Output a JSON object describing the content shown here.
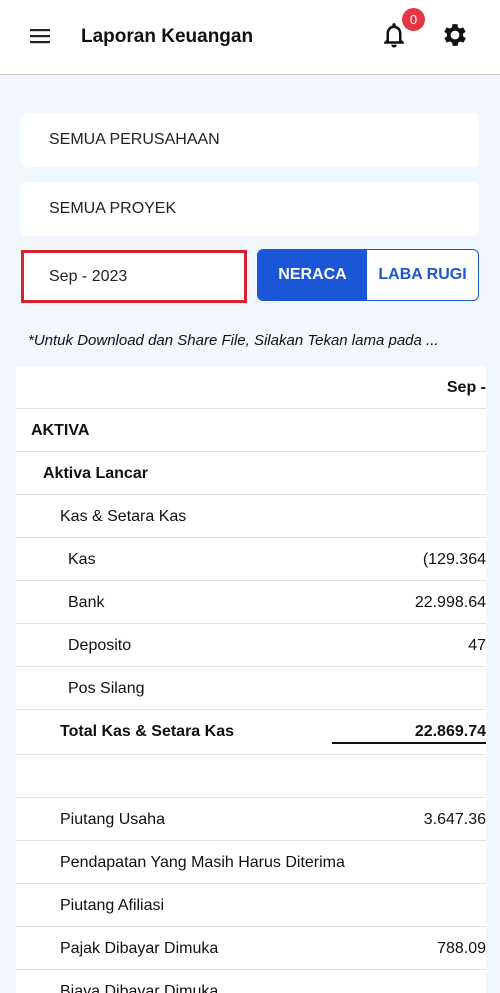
{
  "header": {
    "title": "Laporan Keuangan",
    "notification_count": "0"
  },
  "filters": {
    "company": "SEMUA PERUSAHAAN",
    "project": "SEMUA PROYEK",
    "period": "Sep - 2023"
  },
  "report_toggle": {
    "neraca_label": "NERACA",
    "laba_rugi_label": "LABA RUGI",
    "active": "NERACA"
  },
  "hint": "*Untuk Download dan Share File, Silakan Tekan lama pada ...",
  "table": {
    "column_header": "Sep -",
    "rows": [
      {
        "label": "AKTIVA",
        "value": ""
      },
      {
        "label": "Aktiva Lancar",
        "value": ""
      },
      {
        "label": "Kas & Setara Kas",
        "value": ""
      },
      {
        "label": "Kas",
        "value": "(129.364"
      },
      {
        "label": "Bank",
        "value": "22.998.64"
      },
      {
        "label": "Deposito",
        "value": "47"
      },
      {
        "label": "Pos Silang",
        "value": ""
      },
      {
        "label": "Total Kas & Setara Kas",
        "value": "22.869.74"
      },
      {
        "label": "",
        "value": ""
      },
      {
        "label": "Piutang Usaha",
        "value": "3.647.36"
      },
      {
        "label": "Pendapatan Yang Masih Harus Diterima",
        "value": ""
      },
      {
        "label": "Piutang Afiliasi",
        "value": ""
      },
      {
        "label": "Pajak Dibayar Dimuka",
        "value": "788.09"
      },
      {
        "label": "Biaya Dibayar Dimuka",
        "value": ""
      }
    ]
  },
  "colors": {
    "accent": "#1a56d6",
    "badge": "#e53646",
    "highlight_border": "#d8232f",
    "background": "#f2f7fd"
  },
  "icons": {
    "menu": "hamburger-menu-icon",
    "notifications": "bell-icon",
    "settings": "gear-icon"
  }
}
